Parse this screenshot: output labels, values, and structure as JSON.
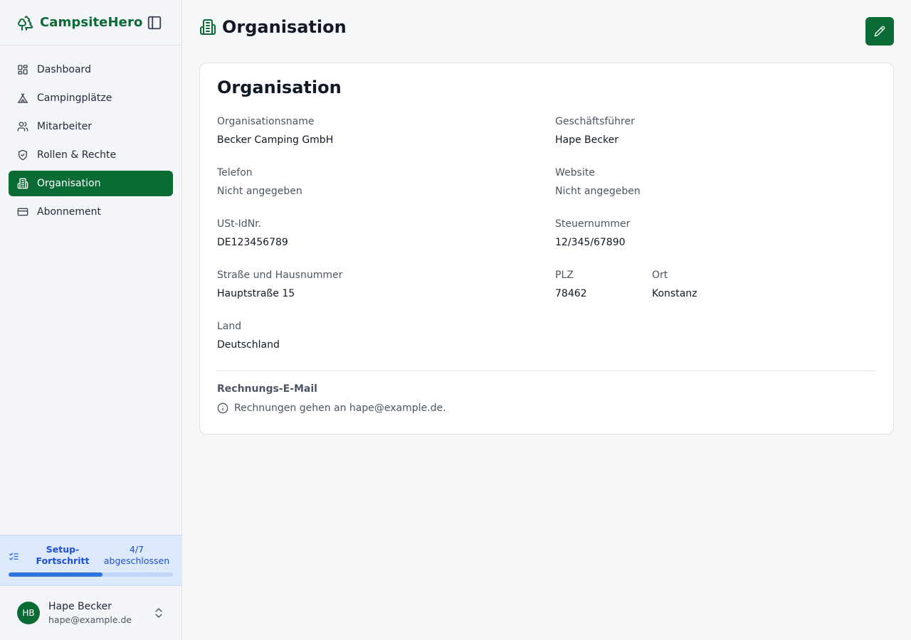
{
  "app": {
    "name": "CampsiteHero"
  },
  "sidebar": {
    "items": [
      {
        "label": "Dashboard",
        "icon": "dashboard-icon"
      },
      {
        "label": "Campingplätze",
        "icon": "tent-icon"
      },
      {
        "label": "Mitarbeiter",
        "icon": "users-icon"
      },
      {
        "label": "Rollen & Rechte",
        "icon": "shield-check-icon"
      },
      {
        "label": "Organisation",
        "icon": "building-icon",
        "active": true
      },
      {
        "label": "Abonnement",
        "icon": "credit-card-icon"
      }
    ],
    "setup": {
      "title": "Setup-Fortschritt",
      "count": "4/7 abgeschlossen",
      "progress": 0.571
    },
    "user": {
      "initials": "HB",
      "name": "Hape Becker",
      "email": "hape@example.de"
    }
  },
  "page": {
    "title": "Organisation"
  },
  "card": {
    "title": "Organisation",
    "fields": {
      "org_name": {
        "label": "Organisationsname",
        "value": "Becker Camping GmbH"
      },
      "ceo": {
        "label": "Geschäftsführer",
        "value": "Hape Becker"
      },
      "phone": {
        "label": "Telefon",
        "value": "Nicht angegeben"
      },
      "website": {
        "label": "Website",
        "value": "Nicht angegeben"
      },
      "vat": {
        "label": "USt-IdNr.",
        "value": "DE123456789"
      },
      "tax": {
        "label": "Steuernummer",
        "value": "12/345/67890"
      },
      "street": {
        "label": "Straße und Hausnummer",
        "value": "Hauptstraße 15"
      },
      "zip": {
        "label": "PLZ",
        "value": "78462"
      },
      "city": {
        "label": "Ort",
        "value": "Konstanz"
      },
      "country": {
        "label": "Land",
        "value": "Deutschland"
      }
    },
    "billing": {
      "title": "Rechnungs-E-Mail",
      "note": "Rechnungen gehen an hape@example.de."
    }
  },
  "colors": {
    "brand": "#0b6b34",
    "setup_bg": "#dce9fb",
    "setup_accent": "#2f73e0"
  }
}
